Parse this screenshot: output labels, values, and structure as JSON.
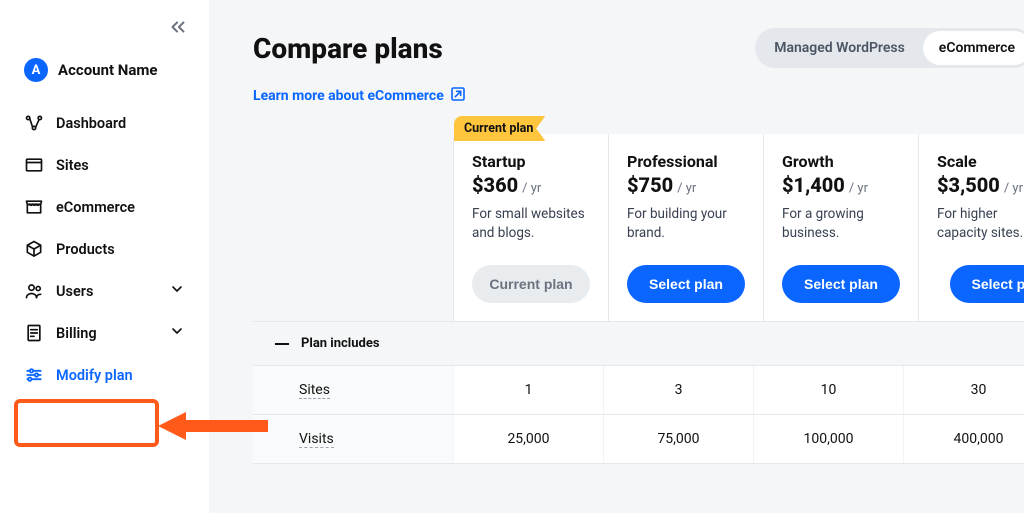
{
  "sidebar": {
    "account": {
      "initial": "A",
      "name": "Account Name"
    },
    "items": [
      {
        "label": "Dashboard"
      },
      {
        "label": "Sites"
      },
      {
        "label": "eCommerce"
      },
      {
        "label": "Products"
      },
      {
        "label": "Users"
      },
      {
        "label": "Billing"
      },
      {
        "label": "Modify plan"
      }
    ]
  },
  "header": {
    "title": "Compare plans",
    "tabs": {
      "managed": "Managed WordPress",
      "ecommerce": "eCommerce"
    },
    "learn_link": "Learn more about eCommerce"
  },
  "plans": {
    "current_tag": "Current plan",
    "per": "/ yr",
    "current_btn": "Current plan",
    "select_btn": "Select plan",
    "items": [
      {
        "name": "Startup",
        "price": "$360",
        "desc": "For small websites and blogs."
      },
      {
        "name": "Professional",
        "price": "$750",
        "desc": "For building your brand."
      },
      {
        "name": "Growth",
        "price": "$1,400",
        "desc": "For a growing business."
      },
      {
        "name": "Scale",
        "price": "$3,500",
        "desc": "For higher capacity sites."
      }
    ]
  },
  "features": {
    "includes_label": "Plan includes",
    "rows": [
      {
        "label": "Sites",
        "values": [
          "1",
          "3",
          "10",
          "30"
        ]
      },
      {
        "label": "Visits",
        "values": [
          "25,000",
          "75,000",
          "100,000",
          "400,000"
        ]
      }
    ]
  }
}
